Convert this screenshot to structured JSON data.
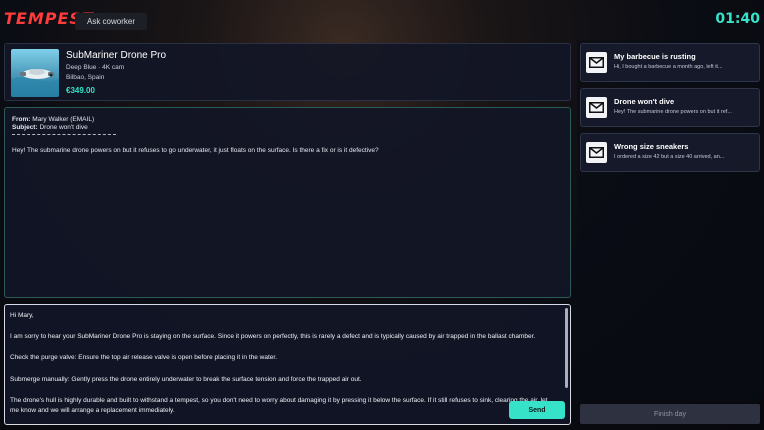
{
  "header": {
    "logo_text": "TEMPEST",
    "ask_coworker_label": "Ask coworker",
    "timer": "01:40"
  },
  "product": {
    "name": "SubMariner Drone Pro",
    "variant": "Deep Blue · 4K cam",
    "location": "Bilbao, Spain",
    "price": "€349.00",
    "image_icon": "drone-product-image"
  },
  "email": {
    "from_label": "From:",
    "from_value": "Mary Walker (EMAIL)",
    "subject_label": "Subject:",
    "subject_value": "Drone won't dive",
    "body": "Hey! The submarine drone powers on but it refuses to go underwater, it just floats on the surface. Is there a fix or is it defective?"
  },
  "reply": {
    "paragraphs": [
      "Hi Mary,",
      "I am sorry to hear your SubMariner Drone Pro is staying on the surface. Since it powers on perfectly, this is rarely a defect and is typically caused by air trapped in the ballast chamber.",
      "Check the purge valve: Ensure the top air release valve is open before placing it in the water.",
      "Submerge manually: Gently press the drone entirely underwater to break the surface tension and force the trapped air out.",
      "The drone's hull is highly durable and built to withstand a tempest, so you don't need to worry about damaging it by pressing it below the surface. If it still refuses to sink, clearing the air, let me know and we will arrange a replacement immediately."
    ],
    "send_label": "Send"
  },
  "tickets": [
    {
      "title": "My barbecue is rusting",
      "preview": "Hi, I bought a barbecue a month ago, left it...",
      "icon": "mail-icon"
    },
    {
      "title": "Drone won't dive",
      "preview": "Hey! The submarine drone powers on but it ref...",
      "icon": "mail-icon"
    },
    {
      "title": "Wrong size sneakers",
      "preview": "I ordered a size 42 but a size 40 arrived, an...",
      "icon": "mail-icon"
    }
  ],
  "footer": {
    "finish_label": "Finish day"
  },
  "colors": {
    "accent": "#36e3c8",
    "logo": "#ff3b3b",
    "panel": "#121626"
  }
}
